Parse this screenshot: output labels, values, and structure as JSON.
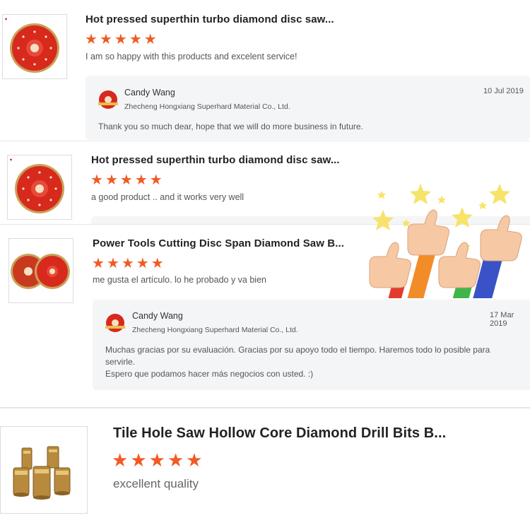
{
  "reviews": [
    {
      "product_title": "Hot pressed superthin turbo diamond disc saw...",
      "rating": 5,
      "review_text": "I am so happy with this products and excelent service!",
      "product_icon": "diamond-saw-disc-red",
      "reply": {
        "name": "Candy Wang",
        "company": "Zhecheng Hongxiang Superhard Material Co., Ltd.",
        "date": "10 Jul 2019",
        "text": "Thank you so much dear, hope that we will do more business in future."
      }
    },
    {
      "product_title": "Hot pressed superthin turbo diamond disc saw...",
      "rating": 5,
      "review_text": "a good product .. and it works very well",
      "product_icon": "diamond-saw-disc-red"
    },
    {
      "product_title": "Power Tools Cutting Disc Span Diamond Saw B...",
      "rating": 5,
      "review_text": "me gusta el artículo. lo he probado y va bien",
      "product_icon": "two-diamond-saw-discs",
      "reply": {
        "name": "Candy Wang",
        "company": "Zhecheng Hongxiang Superhard Material Co., Ltd.",
        "date": "17 Mar 2019",
        "text_lines": [
          "Muchas gracias por su evaluación. Gracias por su apoyo todo el tiempo. Haremos todo lo posible para",
          "servirle.",
          "Espero que podamos hacer más negocios con usted. :)"
        ]
      }
    },
    {
      "product_title": "Tile Hole Saw Hollow Core Diamond Drill Bits B...",
      "rating": 5,
      "review_text": "excellent quality",
      "product_icon": "gold-core-drill-bits"
    }
  ],
  "colors": {
    "star": "#f15a22",
    "reply_bg": "#f4f5f7",
    "disc_red": "#d8291d",
    "disc_rim": "#c9a25a"
  },
  "decoration": "thumbs-up-stars-illustration"
}
